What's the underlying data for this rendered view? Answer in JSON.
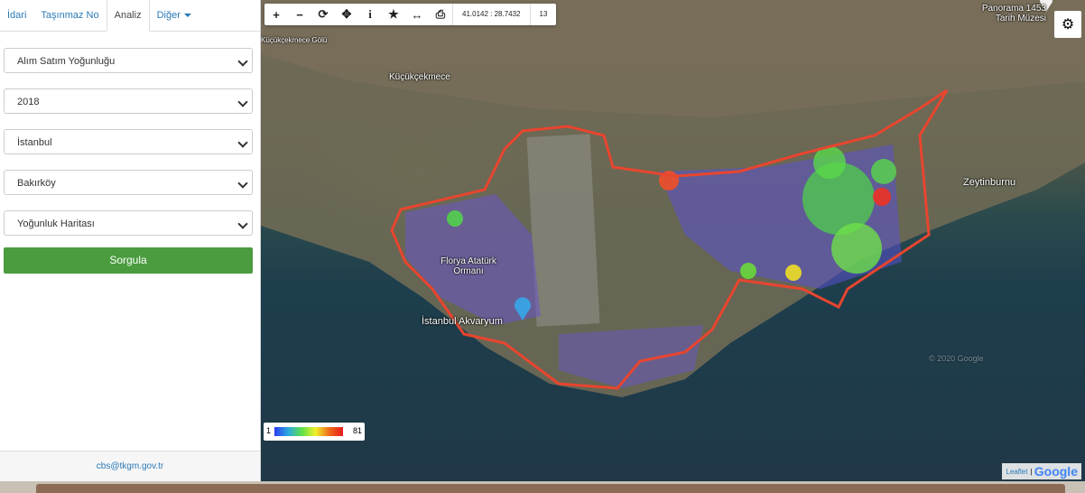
{
  "tabs": [
    {
      "label": "İdari",
      "active": false
    },
    {
      "label": "Taşınmaz No",
      "active": false
    },
    {
      "label": "Analiz",
      "active": true
    },
    {
      "label": "Diğer",
      "active": false
    }
  ],
  "form": {
    "analysis_type": "Alım Satım Yoğunluğu",
    "year": "2018",
    "province": "İstanbul",
    "district": "Bakırköy",
    "display_type": "Yoğunluk Haritası",
    "submit_label": "Sorgula"
  },
  "footer": {
    "email": "cbs@tkgm.gov.tr"
  },
  "map": {
    "toolbar_icons": [
      "zoom-in",
      "zoom-out",
      "refresh",
      "locate",
      "info",
      "favorite",
      "measure",
      "print"
    ],
    "coordinates": "41.0142 : 28.7432",
    "zoom_level": "13",
    "legend": {
      "min": "1",
      "max": "81"
    },
    "attribution": {
      "leaflet": "Leaflet",
      "google": "Google"
    },
    "labels": {
      "kucukcekmece": "Küçükçekmece",
      "florya": "Florya Atatürk Ormanı",
      "akvaryum": "İstanbul Akvaryum",
      "zeytinburnu": "Zeytinburnu",
      "panorama": "Panorama 1453 Tarih Müzesi",
      "golu": "Küçükçekmece Gölü",
      "watermark": "© 2020 Google"
    }
  }
}
